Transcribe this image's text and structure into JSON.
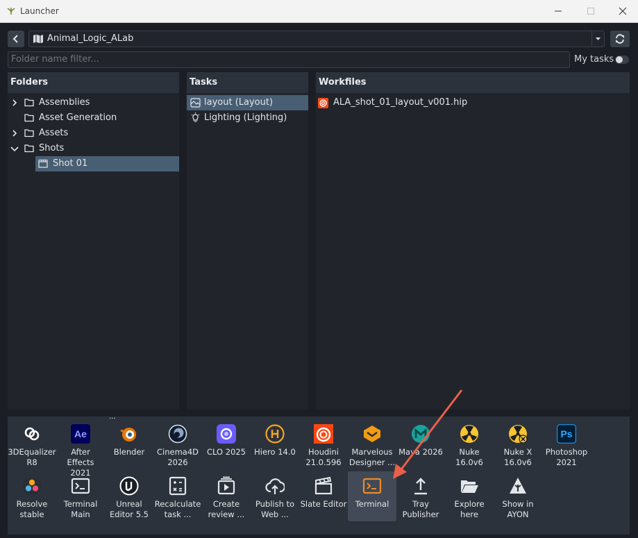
{
  "window": {
    "title": "Launcher"
  },
  "project": {
    "name": "Animal_Logic_ALab"
  },
  "filter": {
    "placeholder": "Folder name filter...",
    "my_tasks_label": "My tasks"
  },
  "folders": {
    "header": "Folders",
    "items": [
      {
        "label": "Assemblies",
        "expand": "collapsed",
        "depth": 0,
        "icon": "folder-icon",
        "selected": false
      },
      {
        "label": "Asset Generation",
        "expand": "none",
        "depth": 0,
        "icon": "folder-icon",
        "selected": false
      },
      {
        "label": "Assets",
        "expand": "collapsed",
        "depth": 0,
        "icon": "folder-icon",
        "selected": false
      },
      {
        "label": "Shots",
        "expand": "expanded",
        "depth": 0,
        "icon": "folder-icon",
        "selected": false
      },
      {
        "label": "Shot 01",
        "expand": "none",
        "depth": 1,
        "icon": "clapperboard-icon",
        "selected": true
      }
    ]
  },
  "tasks": {
    "header": "Tasks",
    "items": [
      {
        "label": "layout (Layout)",
        "icon": "layout-icon",
        "selected": true
      },
      {
        "label": "Lighting (Lighting)",
        "icon": "lightbulb-icon",
        "selected": false
      }
    ]
  },
  "workfiles": {
    "header": "Workfiles",
    "items": [
      {
        "label": "ALA_shot_01_layout_v001.hip",
        "icon": "houdini-icon"
      }
    ]
  },
  "apps": [
    [
      {
        "label": "3DEqualizer\nR8",
        "icon": "3dequalizer-icon"
      },
      {
        "label": "After Effects\n2021",
        "icon": "after-effects-icon"
      },
      {
        "label": "Blender",
        "icon": "blender-icon"
      },
      {
        "label": "Cinema4D\n2026",
        "icon": "cinema4d-icon"
      },
      {
        "label": "CLO 2025",
        "icon": "clo-icon"
      },
      {
        "label": "Hiero 14.0",
        "icon": "hiero-icon"
      },
      {
        "label": "Houdini\n21.0.596",
        "icon": "houdini-icon"
      },
      {
        "label": "Marvelous\nDesigner ...",
        "icon": "marvelous-designer-icon"
      },
      {
        "label": "Maya 2026",
        "icon": "maya-icon"
      },
      {
        "label": "Nuke 16.0v6",
        "icon": "nuke-icon"
      },
      {
        "label": "Nuke X\n16.0v6",
        "icon": "nukex-icon"
      },
      {
        "label": "Photoshop\n2021",
        "icon": "photoshop-icon"
      }
    ],
    [
      {
        "label": "Resolve\nstable",
        "icon": "resolve-icon"
      },
      {
        "label": "Terminal\nMain",
        "icon": "terminal-icon"
      },
      {
        "label": "Unreal\nEditor 5.5",
        "icon": "unreal-icon"
      },
      {
        "label": "Recalculate\ntask ...",
        "icon": "calculator-icon"
      },
      {
        "label": "Create\nreview ...",
        "icon": "review-icon"
      },
      {
        "label": "Publish to\nWeb ...",
        "icon": "cloud-upload-icon"
      },
      {
        "label": "Slate Editor",
        "icon": "clapperboard-icon"
      },
      {
        "label": "Terminal",
        "icon": "terminal-icon",
        "selected": true
      },
      {
        "label": "Tray\nPublisher",
        "icon": "upload-icon"
      },
      {
        "label": "Explore\nhere",
        "icon": "folder-open-icon"
      },
      {
        "label": "Show in\nAYON",
        "icon": "ayon-icon"
      }
    ]
  ],
  "overflow_marker": "...",
  "colors": {
    "accent": "#485e73",
    "annotation_arrow": "#e8604a",
    "background": "#1b1f25",
    "panel": "#2c323b"
  }
}
